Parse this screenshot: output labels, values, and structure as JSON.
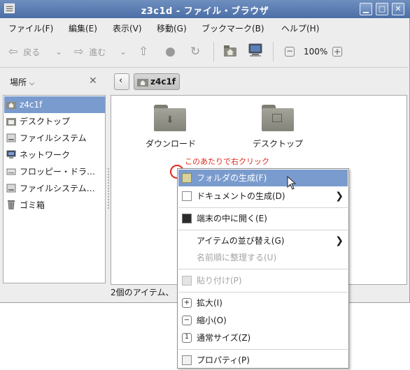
{
  "window": {
    "title": "z3c1d - ファイル・ブラウザ",
    "controls": {
      "minimize": "▁",
      "maximize": "□",
      "close": "✕"
    }
  },
  "menubar": [
    "ファイル(F)",
    "編集(E)",
    "表示(V)",
    "移動(G)",
    "ブックマーク(B)",
    "ヘルプ(H)"
  ],
  "toolbar": {
    "back_label": "戻る",
    "forward_label": "進む",
    "zoom_level": "100%"
  },
  "sidebar": {
    "header": "場所",
    "items": [
      {
        "label": "z4c1f",
        "icon": "home-icon",
        "selected": true
      },
      {
        "label": "デスクトップ",
        "icon": "desktop-icon",
        "selected": false
      },
      {
        "label": "ファイルシステム",
        "icon": "drive-icon",
        "selected": false
      },
      {
        "label": "ネットワーク",
        "icon": "network-icon",
        "selected": false
      },
      {
        "label": "フロッピー・ドラ…",
        "icon": "floppy-icon",
        "selected": false
      },
      {
        "label": "ファイルシステム…",
        "icon": "drive-icon",
        "selected": false
      },
      {
        "label": "ゴミ箱",
        "icon": "trash-icon",
        "selected": false
      }
    ]
  },
  "location": {
    "current": "z4c1f"
  },
  "content": {
    "items": [
      {
        "label": "ダウンロード",
        "icon": "download-folder-icon"
      },
      {
        "label": "デスクトップ",
        "icon": "desktop-folder-icon"
      }
    ],
    "status": "2個のアイテム、"
  },
  "annotation": {
    "text": "このあたりで右クリック",
    "color": "#e0281b"
  },
  "context_menu": {
    "items": [
      {
        "label": "フォルダの生成(F)",
        "icon": "new-folder-icon",
        "highlighted": true
      },
      {
        "label": "ドキュメントの生成(D)",
        "icon": "new-document-icon",
        "submenu": true
      },
      {
        "label": "端末の中に開く(E)",
        "icon": "terminal-icon"
      },
      {
        "label": "アイテムの並び替え(G)",
        "submenu": true
      },
      {
        "label": "名前順に整理する(U)",
        "disabled": true
      },
      {
        "label": "貼り付け(P)",
        "icon": "paste-icon",
        "disabled": true
      },
      {
        "label": "拡大(I)",
        "icon": "zoom-in-icon"
      },
      {
        "label": "縮小(O)",
        "icon": "zoom-out-icon"
      },
      {
        "label": "通常サイズ(Z)",
        "icon": "zoom-normal-icon"
      },
      {
        "label": "プロパティ(P)",
        "icon": "properties-icon"
      }
    ]
  },
  "colors": {
    "selection": "#7a9bcd",
    "titlebar": "#5b7db3",
    "annotation": "#e0281b"
  }
}
